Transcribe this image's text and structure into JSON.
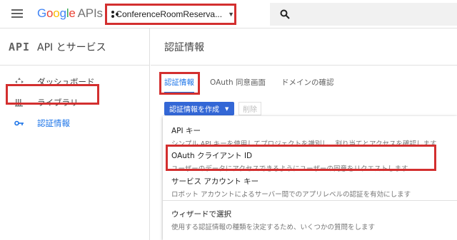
{
  "header": {
    "logo": {
      "g1": "G",
      "g2": "o",
      "g3": "o",
      "g4": "g",
      "g5": "l",
      "g6": "e",
      "apis": "APIs"
    },
    "project_name": "ConferenceRoomReserva...",
    "project_caret": "▼"
  },
  "sidebar": {
    "api_badge": "API",
    "title": "API とサービス",
    "items": [
      {
        "label": "ダッシュボード",
        "icon": "dashboard-icon"
      },
      {
        "label": "ライブラリ",
        "icon": "library-icon"
      },
      {
        "label": "認証情報",
        "icon": "key-icon",
        "active": true
      }
    ]
  },
  "main": {
    "title": "認証情報",
    "tabs": [
      {
        "label": "認証情報",
        "active": true
      },
      {
        "label": "OAuth 同意画面"
      },
      {
        "label": "ドメインの確認"
      }
    ],
    "create_button": "認証情報を作成",
    "delete_button": "削除",
    "menu": [
      {
        "label": "API キー",
        "desc": "シンプル API キーを使用してプロジェクトを識別し、割り当てとアクセスを確認します"
      },
      {
        "label": "OAuth クライアント ID",
        "desc": "ユーザーのデータにアクセスできるようにユーザーの同意をリクエストします",
        "highlighted": true
      },
      {
        "label": "サービス アカウント キー",
        "desc": "ロボット アカウントによるサーバー間でのアプリレベルの認証を有効にします"
      },
      {
        "label": "ウィザードで選択",
        "desc": "使用する認証情報の種類を決定するため、いくつかの質問をします"
      }
    ]
  },
  "colors": {
    "accent": "#3367d6",
    "highlight": "#d32f2f",
    "active": "#1a73e8"
  }
}
